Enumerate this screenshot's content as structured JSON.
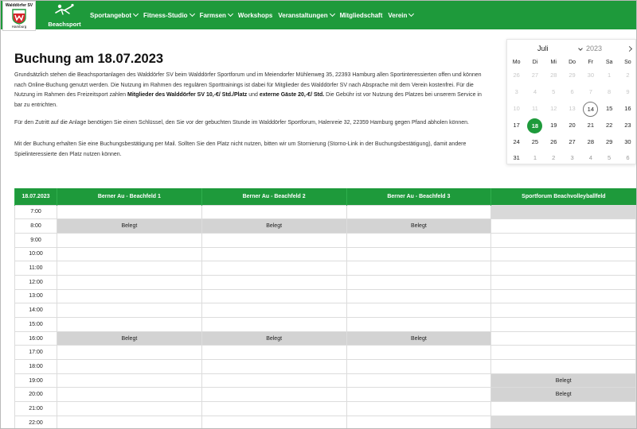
{
  "nav": {
    "logo_line1": "Walddörfer SV",
    "logo_line2": "Hamburg",
    "beach_label": "Beachsport",
    "menu": [
      {
        "label": "Sportangebot",
        "dropdown": true
      },
      {
        "label": "Fitness-Studio",
        "dropdown": true
      },
      {
        "label": "Farmsen",
        "dropdown": true
      },
      {
        "label": "Workshops",
        "dropdown": false
      },
      {
        "label": "Veranstaltungen",
        "dropdown": true
      },
      {
        "label": "Mitgliedschaft",
        "dropdown": false
      },
      {
        "label": "Verein",
        "dropdown": true
      }
    ],
    "brand_color": "#1e9a3b"
  },
  "page": {
    "title": "Buchung am 18.07.2023",
    "p1_a": "Grundsätzlich stehen die Beachsportanlagen des Walddörfer SV beim Walddörfer Sportforum und im Meiendorfer Mühlenweg 35, 22393 Hamburg allen Sportinteressierten offen und können nach Online-Buchung genutzt werden. Die Nutzung im Rahmen des regulären Sporttrainings ist dabei für Mitglieder des Walddörfer SV nach Absprache mit dem Verein kostenfrei. Für die Nutzung im Rahmen des Freizeitsport zahlen ",
    "p1_b": "Mitglieder des Walddörfer SV 10,-€/ Std./Platz",
    "p1_c": " und ",
    "p1_d": "externe Gäste 20,-€/ Std.",
    "p1_e": " Die Gebühr ist vor Nutzung des Platzes bei unserem Service in bar zu entrichten.",
    "p2": "Für den Zutritt auf die Anlage benötigen Sie einen Schlüssel, den Sie vor der gebuchten Stunde im Walddörfer Sportforum, Halenreie 32, 22359 Hamburg gegen Pfand abholen können.",
    "p3": "Mit der Buchung erhalten Sie eine Buchungsbestätigung per Mail. Sollten Sie den Platz nicht nutzen, bitten wir um Stornierung (Storno-Link in der Buchungsbestätigung), damit andere Spielinteressierte den Platz nutzen können."
  },
  "calendar": {
    "month": "Juli",
    "year": "2023",
    "weekdays": [
      "Mo",
      "Di",
      "Mi",
      "Do",
      "Fr",
      "Sa",
      "So"
    ],
    "weeks": [
      [
        {
          "d": "26",
          "s": "dis"
        },
        {
          "d": "27",
          "s": "dis"
        },
        {
          "d": "28",
          "s": "dis"
        },
        {
          "d": "29",
          "s": "dis"
        },
        {
          "d": "30",
          "s": "dis"
        },
        {
          "d": "1",
          "s": "dis"
        },
        {
          "d": "2",
          "s": "dis"
        }
      ],
      [
        {
          "d": "3",
          "s": "dis"
        },
        {
          "d": "4",
          "s": "dis"
        },
        {
          "d": "5",
          "s": "dis"
        },
        {
          "d": "6",
          "s": "dis"
        },
        {
          "d": "7",
          "s": "dis"
        },
        {
          "d": "8",
          "s": "dis"
        },
        {
          "d": "9",
          "s": "dis"
        }
      ],
      [
        {
          "d": "10",
          "s": "dis"
        },
        {
          "d": "11",
          "s": "dis"
        },
        {
          "d": "12",
          "s": "dis"
        },
        {
          "d": "13",
          "s": "dis"
        },
        {
          "d": "14",
          "s": "today"
        },
        {
          "d": "15",
          "s": "en"
        },
        {
          "d": "16",
          "s": "en"
        }
      ],
      [
        {
          "d": "17",
          "s": "en"
        },
        {
          "d": "18",
          "s": "sel"
        },
        {
          "d": "19",
          "s": "en"
        },
        {
          "d": "20",
          "s": "en"
        },
        {
          "d": "21",
          "s": "en"
        },
        {
          "d": "22",
          "s": "en"
        },
        {
          "d": "23",
          "s": "en"
        }
      ],
      [
        {
          "d": "24",
          "s": "en"
        },
        {
          "d": "25",
          "s": "en"
        },
        {
          "d": "26",
          "s": "en"
        },
        {
          "d": "27",
          "s": "en"
        },
        {
          "d": "28",
          "s": "en"
        },
        {
          "d": "29",
          "s": "en"
        },
        {
          "d": "30",
          "s": "en"
        }
      ],
      [
        {
          "d": "31",
          "s": "en"
        },
        {
          "d": "1",
          "s": "out"
        },
        {
          "d": "2",
          "s": "out"
        },
        {
          "d": "3",
          "s": "out"
        },
        {
          "d": "4",
          "s": "out"
        },
        {
          "d": "5",
          "s": "out"
        },
        {
          "d": "6",
          "s": "out"
        }
      ]
    ]
  },
  "booking": {
    "date_header": "18.07.2023",
    "courts": [
      "Berner Au - Beachfeld 1",
      "Berner Au - Beachfeld 2",
      "Berner Au - Beachfeld 3",
      "Sportforum Beachvolleyballfeld"
    ],
    "rows": [
      {
        "time": "7:00",
        "cells": [
          "",
          "",
          "",
          "grey"
        ]
      },
      {
        "time": "8:00",
        "cells": [
          "Belegt",
          "Belegt",
          "Belegt",
          ""
        ]
      },
      {
        "time": "9:00",
        "cells": [
          "",
          "",
          "",
          ""
        ]
      },
      {
        "time": "10:00",
        "cells": [
          "",
          "",
          "",
          ""
        ]
      },
      {
        "time": "11:00",
        "cells": [
          "",
          "",
          "",
          ""
        ]
      },
      {
        "time": "12:00",
        "cells": [
          "",
          "",
          "",
          ""
        ]
      },
      {
        "time": "13:00",
        "cells": [
          "",
          "",
          "",
          ""
        ]
      },
      {
        "time": "14:00",
        "cells": [
          "",
          "",
          "",
          ""
        ]
      },
      {
        "time": "15:00",
        "cells": [
          "",
          "",
          "",
          ""
        ]
      },
      {
        "time": "16:00",
        "cells": [
          "Belegt",
          "Belegt",
          "Belegt",
          ""
        ]
      },
      {
        "time": "17:00",
        "cells": [
          "",
          "",
          "",
          ""
        ]
      },
      {
        "time": "18:00",
        "cells": [
          "",
          "",
          "",
          ""
        ]
      },
      {
        "time": "19:00",
        "cells": [
          "",
          "",
          "",
          "Belegt"
        ]
      },
      {
        "time": "20:00",
        "cells": [
          "",
          "",
          "",
          "Belegt"
        ]
      },
      {
        "time": "21:00",
        "cells": [
          "",
          "",
          "",
          ""
        ]
      },
      {
        "time": "22:00",
        "cells": [
          "",
          "",
          "",
          "grey"
        ]
      }
    ]
  }
}
